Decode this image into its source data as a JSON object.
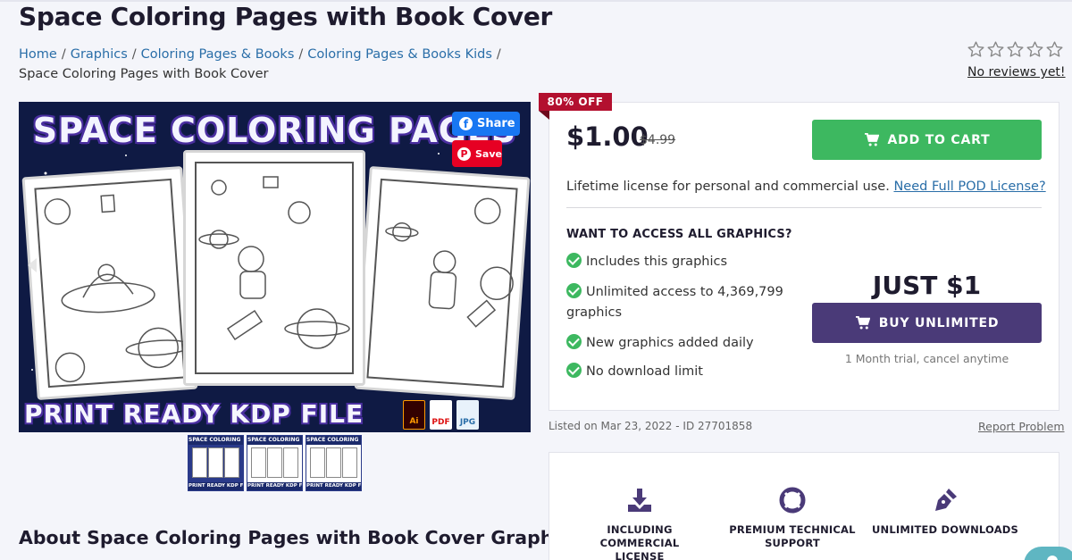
{
  "page": {
    "title": "Space Coloring Pages with Book Cover"
  },
  "breadcrumb": {
    "items": [
      "Home",
      "Graphics",
      "Coloring Pages & Books",
      "Coloring Pages & Books Kids"
    ],
    "separator": "/",
    "current": "Space Coloring Pages with Book Cover"
  },
  "rating": {
    "stars_filled": 0,
    "stars_total": 5,
    "label": "No reviews yet!"
  },
  "preview": {
    "title_text": "SPACE COLORING PAGES",
    "bottom_text": "PRINT READY KDP FILE",
    "file_icons": [
      "Ai",
      "PDF",
      "JPG"
    ],
    "share_label": "Share",
    "save_label": "Save",
    "thumbnails": [
      {
        "top": "SPACE COLORING PAGES",
        "bottom": "PRINT READY KDP FILE"
      },
      {
        "top": "SPACE COLORING PAGES",
        "bottom": "PRINT READY KDP FILE"
      },
      {
        "top": "SPACE COLORING PAGES",
        "bottom": "PRINT READY KDP FILE"
      }
    ]
  },
  "offer": {
    "badge": "80% OFF",
    "price": "$1.00",
    "old_price": "$4.99",
    "add_to_cart": "ADD TO CART",
    "license_text": "Lifetime license for personal and commercial use.",
    "license_link": "Need Full POD License?"
  },
  "unlimited": {
    "heading": "WANT TO ACCESS ALL GRAPHICS?",
    "features": [
      "Includes this graphics",
      "Unlimited access to 4,369,799 graphics",
      "New graphics added daily",
      "No download limit"
    ],
    "price_label": "JUST $1",
    "button": "BUY UNLIMITED",
    "trial": "1 Month trial, cancel anytime"
  },
  "listing": {
    "listed": "Listed on Mar 23, 2022 - ID 27701858",
    "report": "Report Problem"
  },
  "perks": [
    {
      "icon": "download-icon",
      "label_line1": "INCLUDING COMMERCIAL",
      "label_line2": "LICENSE"
    },
    {
      "icon": "lifebuoy-icon",
      "label_line1": "PREMIUM TECHNICAL",
      "label_line2": "SUPPORT"
    },
    {
      "icon": "pen-nib-icon",
      "label_line1": "UNLIMITED DOWNLOADS",
      "label_line2": ""
    }
  ],
  "about": {
    "heading": "About Space Coloring Pages with Book Cover Graphic"
  },
  "colors": {
    "green": "#3db860",
    "purple": "#4a3a78",
    "badge_red": "#b3102f",
    "link_blue": "#2a6ea8",
    "facebook": "#1877f2",
    "pinterest": "#e60023"
  }
}
